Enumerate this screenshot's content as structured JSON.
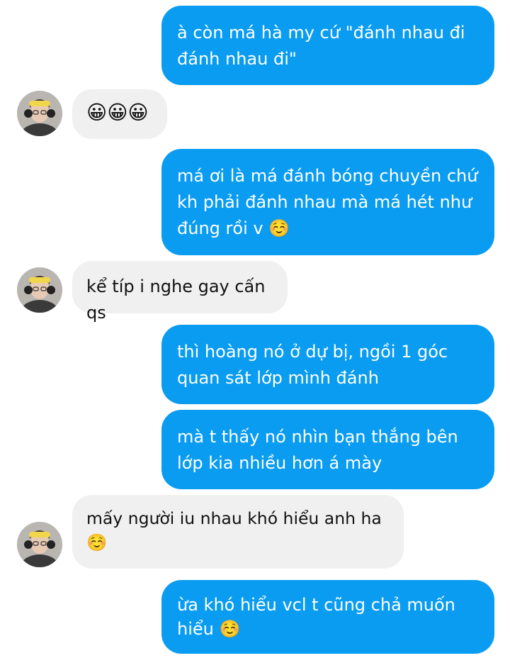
{
  "colors": {
    "outgoing": "#0a9cf1",
    "incoming": "#f0f0f0",
    "text_dark": "#111111",
    "text_light": "#ffffff"
  },
  "messages": [
    {
      "side": "out",
      "text": "à còn má hà my cứ \"đánh nhau đi đánh nhau đi\""
    },
    {
      "side": "in",
      "text": "😀😀😀",
      "avatar": "avatar-icon"
    },
    {
      "side": "out",
      "text": "má ơi là má đánh bóng chuyền chứ kh phải đánh nhau mà má hét như đúng rồi v ☺️"
    },
    {
      "side": "in",
      "text": "kể típ i nghe gay cấn qs",
      "avatar": "avatar-icon"
    },
    {
      "side": "out",
      "text": "thì hoàng nó ở dự bị, ngồi 1 góc quan sát lớp mình đánh"
    },
    {
      "side": "out",
      "text": "mà t thấy nó nhìn bạn thắng bên lớp kia nhiều hơn á mày"
    },
    {
      "side": "in",
      "text": "mấy người iu nhau khó hiểu anh ha ☺️",
      "avatar": "avatar-icon"
    },
    {
      "side": "out",
      "text": "ừa khó hiểu vcl t cũng chả muốn hiểu ☺️"
    }
  ]
}
